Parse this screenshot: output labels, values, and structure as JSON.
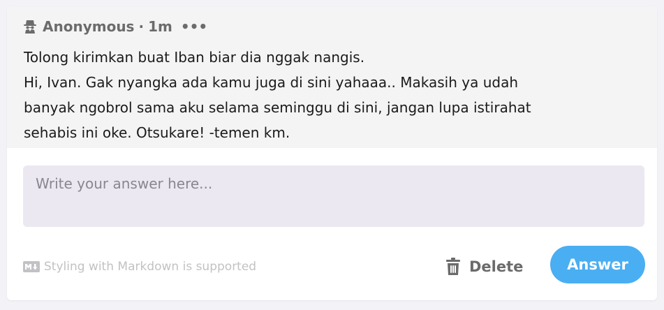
{
  "question": {
    "author": "Anonymous",
    "separator": "·",
    "time_ago": "1m",
    "more_label": "•••",
    "lines": [
      "Tolong kirimkan buat Iban biar dia nggak nangis.",
      "Hi, Ivan. Gak nyangka ada kamu juga di sini yahaaa.. Makasih ya udah",
      "banyak ngobrol sama aku selama seminggu di sini, jangan lupa istirahat",
      "sehabis ini oke. Otsukare! -temen km."
    ]
  },
  "answer": {
    "placeholder": "Write your answer here...",
    "markdown_note": "Styling with Markdown is supported",
    "delete_label": "Delete",
    "submit_label": "Answer"
  },
  "icons": {
    "author_icon": "spy-icon",
    "markdown_icon": "markdown-icon",
    "delete_icon": "trash-icon"
  },
  "colors": {
    "accent": "#4aaef2",
    "question_bg": "#f4f4f5",
    "input_bg": "#ebe8f1",
    "muted_text": "#6b6b6b"
  }
}
